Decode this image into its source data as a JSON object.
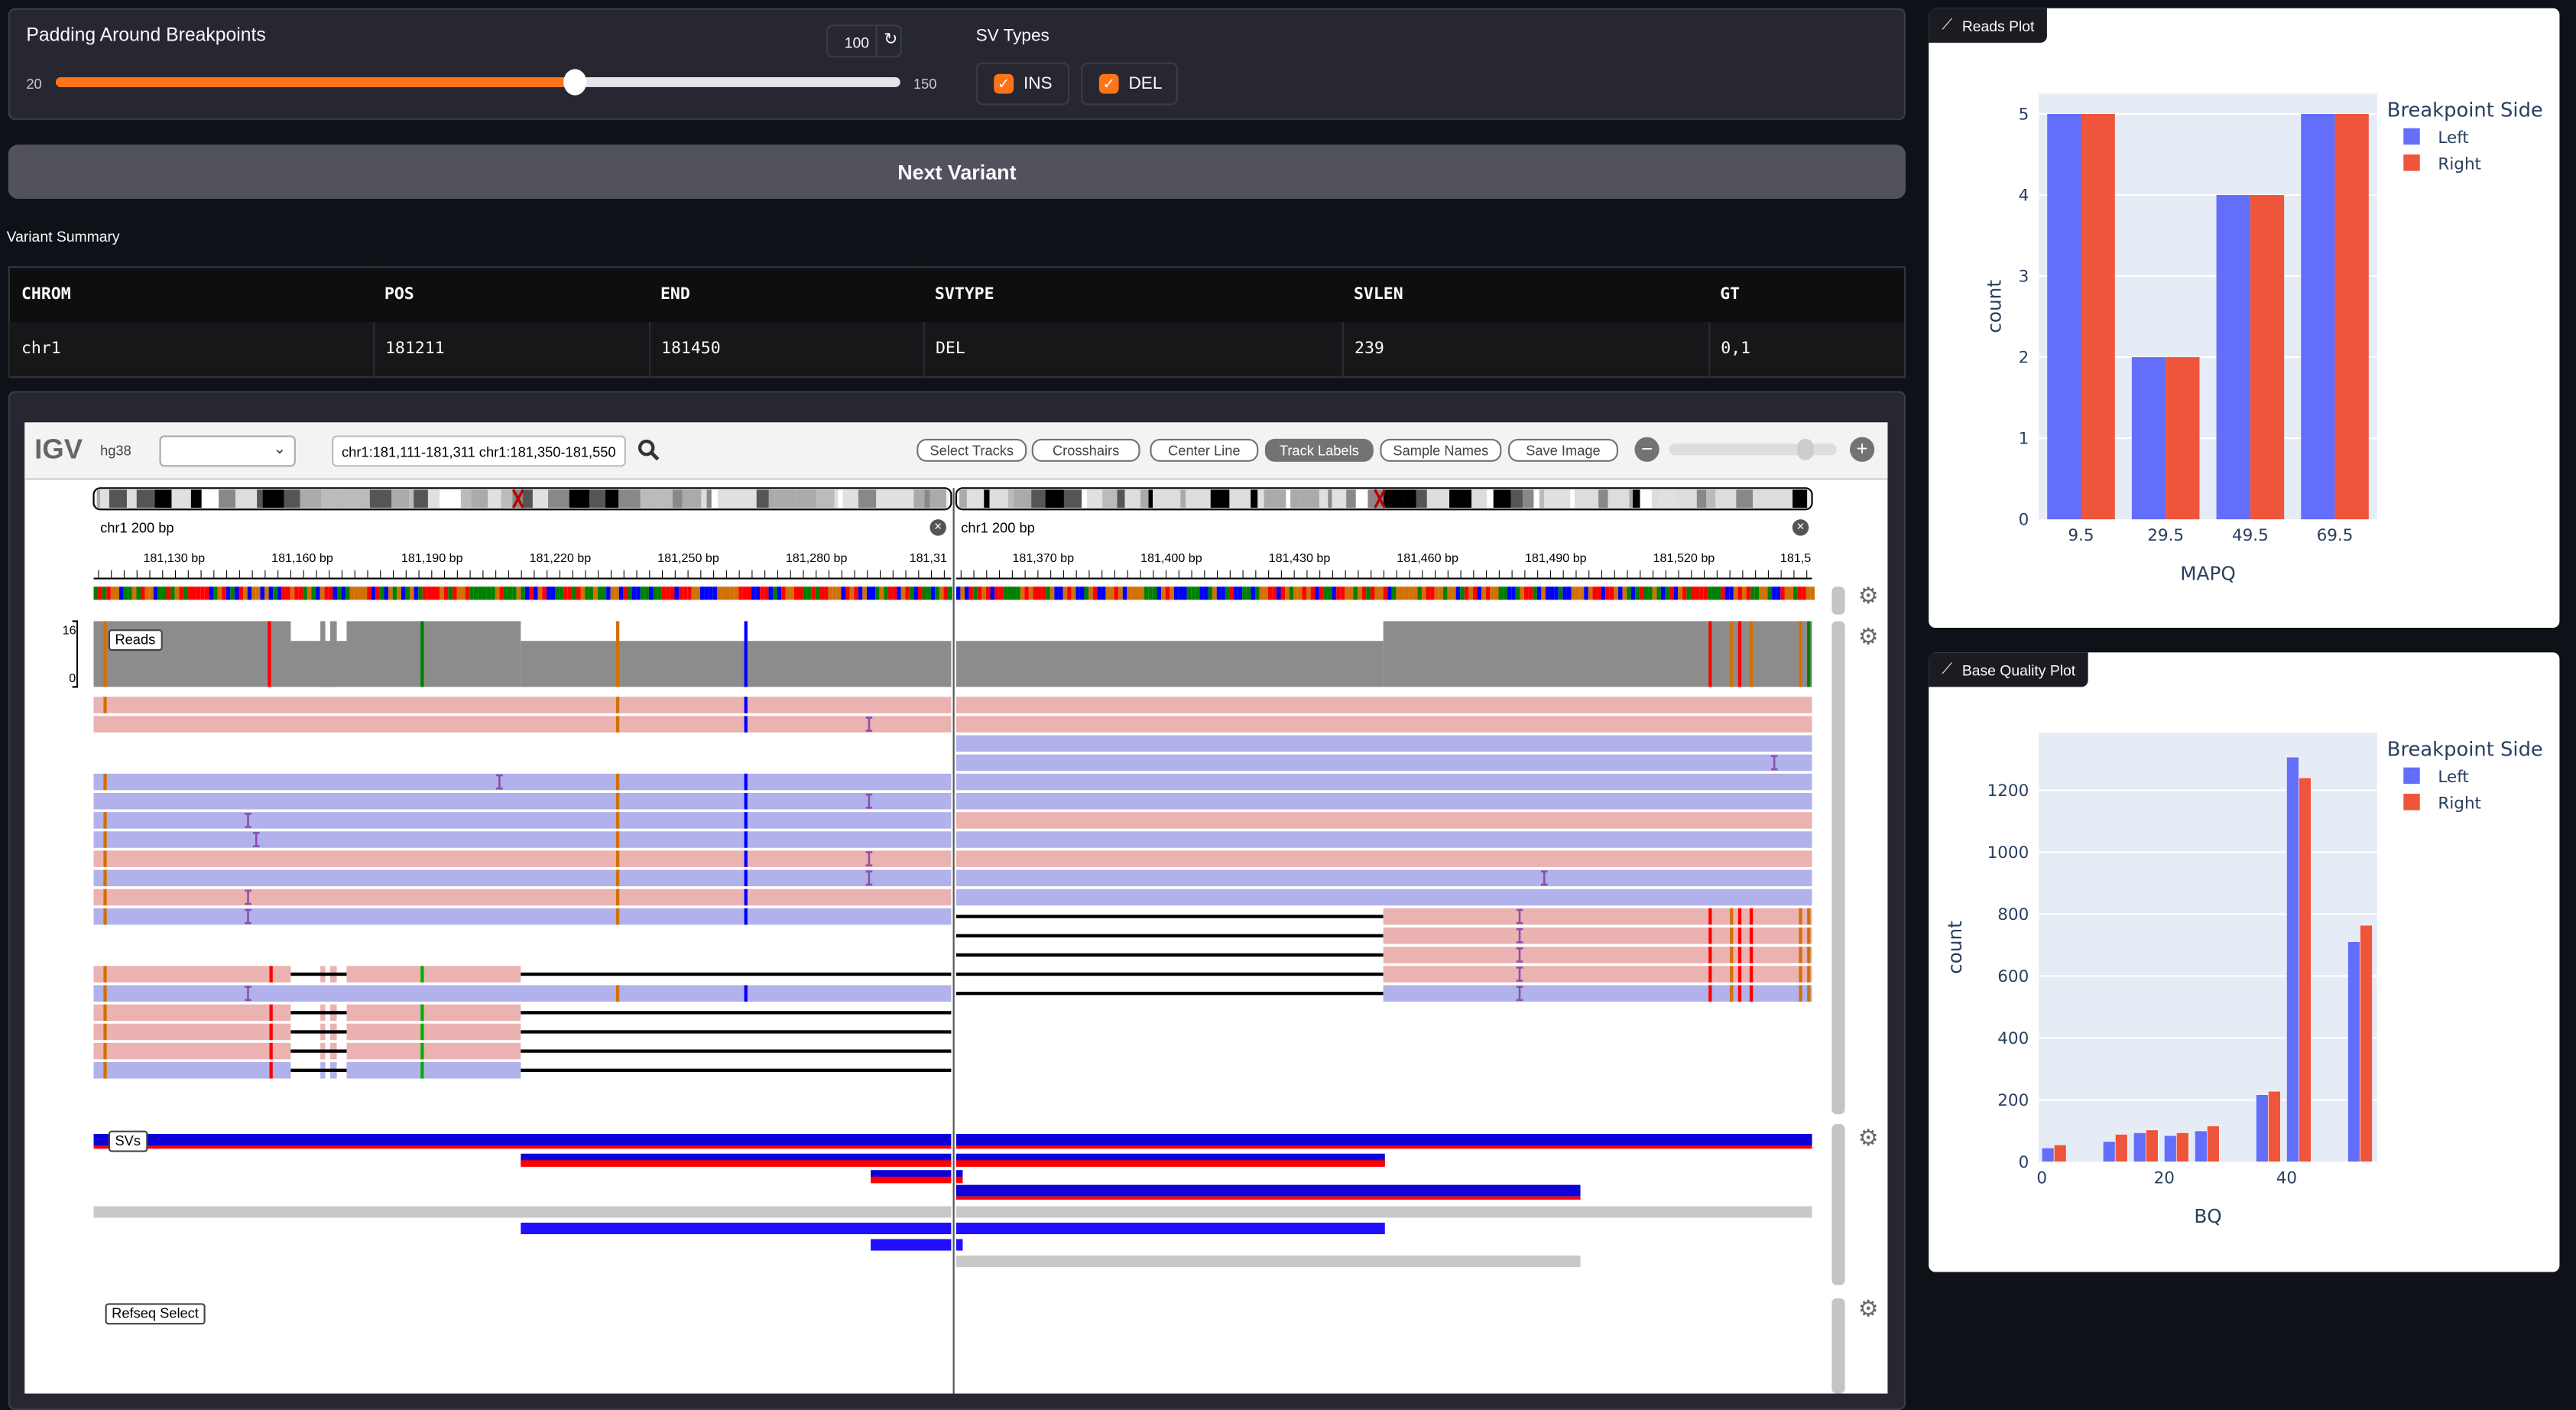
{
  "controls": {
    "padding_label": "Padding Around Breakpoints",
    "padding_value": "100",
    "padding_min": "20",
    "padding_max": "150",
    "padding_fraction": 0.615,
    "sv_types_label": "SV Types",
    "sv_types": [
      {
        "label": "INS",
        "checked": true
      },
      {
        "label": "DEL",
        "checked": true
      }
    ],
    "accent": "#ff7417"
  },
  "next_button": "Next Variant",
  "summary": {
    "title": "Variant Summary",
    "columns": [
      "CHROM",
      "POS",
      "END",
      "SVTYPE",
      "SVLEN",
      "GT"
    ],
    "row": [
      "chr1",
      "181211",
      "181450",
      "DEL",
      "239",
      "0,1"
    ]
  },
  "igv": {
    "logo": "IGV",
    "genome": "hg38",
    "locus": "chr1:181,111-181,311 chr1:181,350-181,550",
    "buttons": [
      "Select Tracks",
      "Crosshairs",
      "Center Line",
      "Track Labels",
      "Sample Names",
      "Save Image"
    ],
    "active_button": "Track Labels",
    "panels": [
      {
        "label": "chr1 200 bp",
        "ticks": [
          "181,130 bp",
          "181,160 bp",
          "181,190 bp",
          "181,220 bp",
          "181,250 bp",
          "181,280 bp",
          "181,31"
        ]
      },
      {
        "label": "chr1 200 bp",
        "ticks": [
          "181,370 bp",
          "181,400 bp",
          "181,430 bp",
          "181,460 bp",
          "181,490 bp",
          "181,520 bp",
          "181,5"
        ]
      }
    ],
    "coverage_max": "16",
    "coverage_min": "0",
    "tracks": [
      "Reads",
      "SVs",
      "Refseq Select"
    ],
    "colors": {
      "fwd": "#ebb2b2",
      "rev": "#b1b1eb",
      "sv_blue": "#0d00d9",
      "sv_red": "#ff0000"
    }
  },
  "reads_plot": {
    "tab": "Reads Plot"
  },
  "bq_plot": {
    "tab": "Base Quality Plot"
  },
  "chart_data": [
    {
      "type": "bar",
      "title": "Reads Plot",
      "xlabel": "MAPQ",
      "ylabel": "count",
      "categories": [
        "9.5",
        "29.5",
        "49.5",
        "69.5"
      ],
      "series": [
        {
          "name": "Left",
          "color": "#636efa",
          "values": [
            5,
            2,
            4,
            5
          ]
        },
        {
          "name": "Right",
          "color": "#ef553b",
          "values": [
            5,
            2,
            4,
            5
          ]
        }
      ],
      "yticks": [
        "0",
        "1",
        "2",
        "3",
        "4",
        "5"
      ],
      "ylim": [
        0,
        5.25
      ],
      "legend_title": "Breakpoint Side",
      "legend_position": "top-right",
      "grid": true
    },
    {
      "type": "bar",
      "title": "Base Quality Plot",
      "xlabel": "BQ",
      "ylabel": "count",
      "x": [
        2,
        12,
        17,
        22,
        27,
        37,
        42,
        52
      ],
      "series": [
        {
          "name": "Left",
          "color": "#636efa",
          "values": [
            45,
            66,
            94,
            85,
            100,
            217,
            1307,
            711
          ]
        },
        {
          "name": "Right",
          "color": "#ef553b",
          "values": [
            55,
            89,
            103,
            94,
            116,
            228,
            1240,
            764
          ]
        }
      ],
      "xticks": [
        "0",
        "20",
        "40"
      ],
      "yticks": [
        "0",
        "200",
        "400",
        "600",
        "800",
        "1000",
        "1200"
      ],
      "xlim": [
        -0.5,
        54.8
      ],
      "ylim": [
        0,
        1385
      ],
      "legend_title": "Breakpoint Side",
      "legend_position": "top-right",
      "grid": true
    }
  ]
}
